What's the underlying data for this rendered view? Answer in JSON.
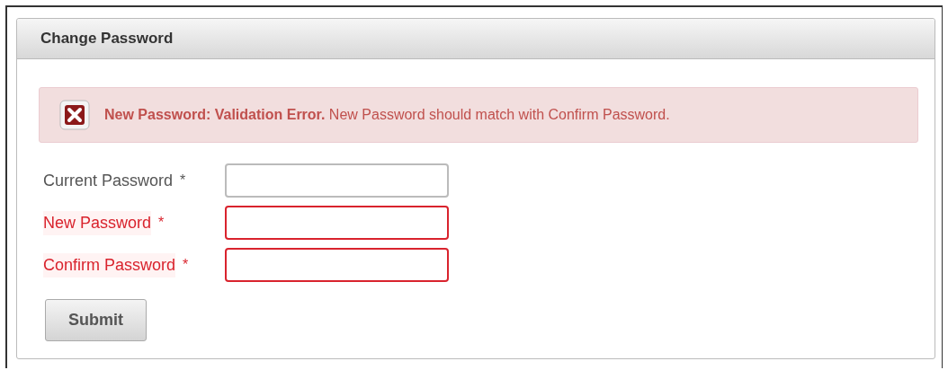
{
  "panel": {
    "title": "Change Password"
  },
  "error": {
    "title": "New Password: Validation Error.",
    "message": "New Password should match with Confirm Password."
  },
  "fields": [
    {
      "label": "Current Password",
      "required_mark": "*",
      "invalid": false
    },
    {
      "label": "New Password",
      "required_mark": "*",
      "invalid": true
    },
    {
      "label": "Confirm Password",
      "required_mark": "*",
      "invalid": true
    }
  ],
  "submit": {
    "label": "Submit"
  }
}
